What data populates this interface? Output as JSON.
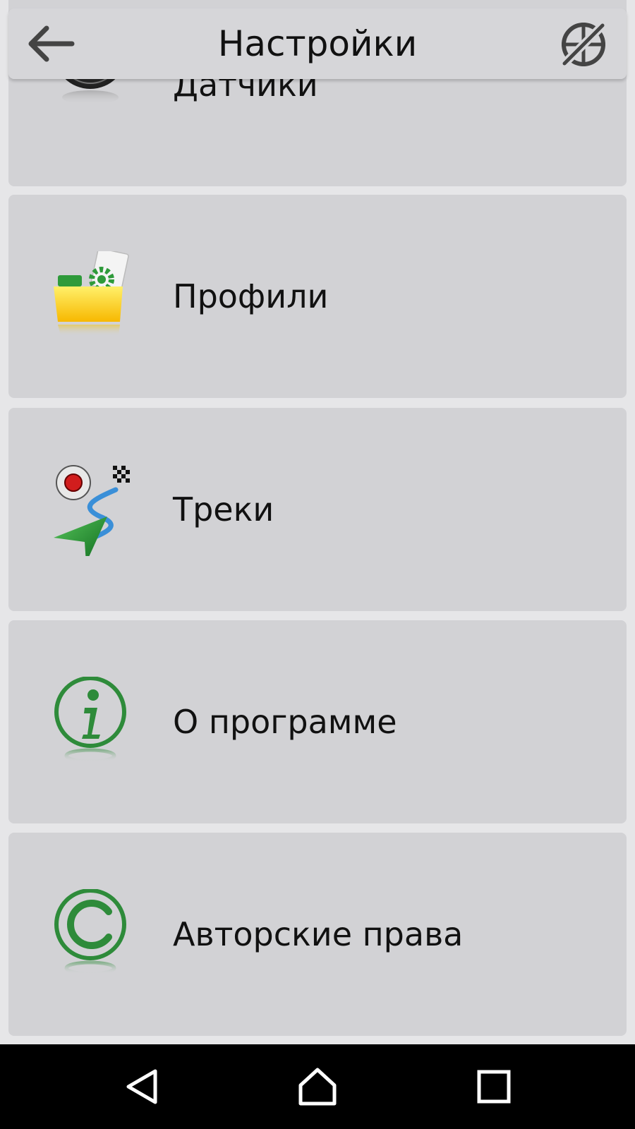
{
  "header": {
    "title": "Настройки",
    "back_icon": "arrow-left-icon",
    "gps_icon": "gps-off-icon"
  },
  "items": [
    {
      "label": "Датчики",
      "icon": "speedometer-icon"
    },
    {
      "label": "Профили",
      "icon": "profile-folder-icon"
    },
    {
      "label": "Треки",
      "icon": "tracks-icon"
    },
    {
      "label": "О программе",
      "icon": "info-icon"
    },
    {
      "label": "Авторские права",
      "icon": "copyright-icon"
    }
  ],
  "navbar": {
    "back_icon": "nav-back-icon",
    "home_icon": "nav-home-icon",
    "recents_icon": "nav-recents-icon"
  },
  "colors": {
    "card_bg": "#d2d2d5",
    "page_bg": "#e6e6e8",
    "accent_green": "#2e8b3a",
    "navbar_bg": "#000000"
  }
}
